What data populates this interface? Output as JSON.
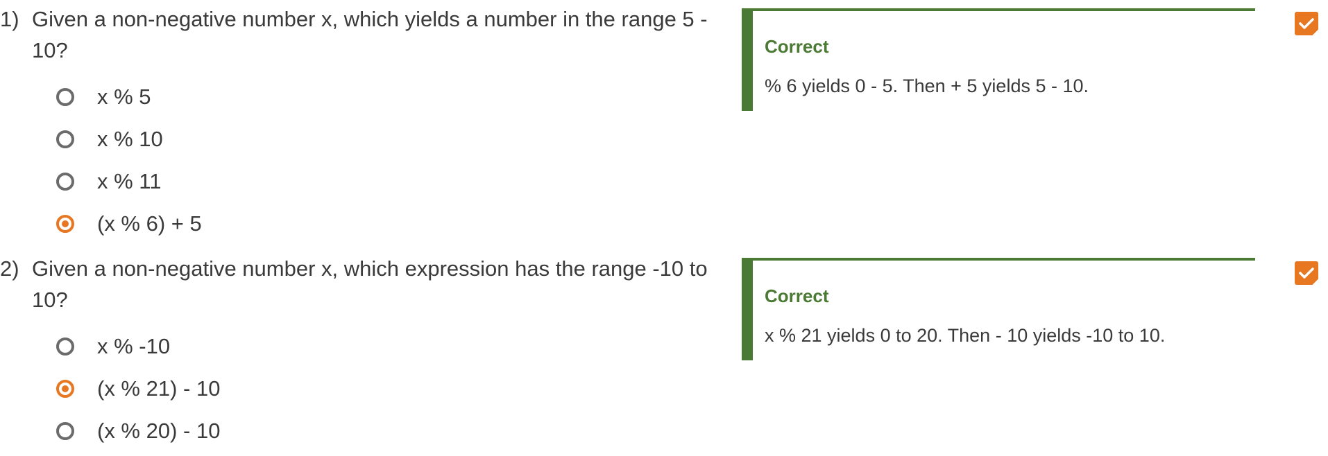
{
  "questions": [
    {
      "number": "1)",
      "prompt": "Given a non-negative number x, which yields a number in the range 5 - 10?",
      "choices": [
        {
          "label": "x % 5",
          "selected": false
        },
        {
          "label": "x % 10",
          "selected": false
        },
        {
          "label": "x % 11",
          "selected": false
        },
        {
          "label": "(x % 6) + 5",
          "selected": true
        }
      ],
      "feedback": {
        "title": "Correct",
        "text": "% 6 yields 0 - 5. Then + 5 yields 5 - 10."
      },
      "status_icon": "checkmark-icon"
    },
    {
      "number": "2)",
      "prompt": "Given a non-negative number x, which expression has the range -10 to 10?",
      "choices": [
        {
          "label": "x % -10",
          "selected": false
        },
        {
          "label": "(x % 21) - 10",
          "selected": true
        },
        {
          "label": "(x % 20) - 10",
          "selected": false
        }
      ],
      "feedback": {
        "title": "Correct",
        "text": "x % 21 yields 0 to 20. Then - 10 yields -10 to 10."
      },
      "status_icon": "checkmark-icon"
    }
  ],
  "colors": {
    "accent": "#e87722",
    "correct": "#4a7a34",
    "radio_border": "#6b6b6b",
    "text": "#3a3a3a"
  }
}
